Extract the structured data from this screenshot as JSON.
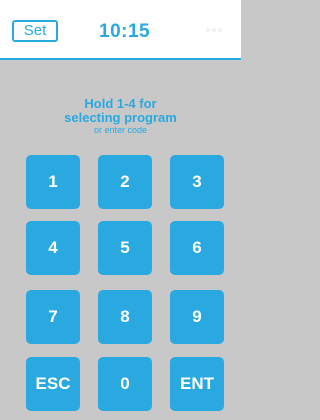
{
  "header": {
    "set_label": "Set",
    "time": "10:15"
  },
  "prompt": {
    "line1": "Hold 1-4 for",
    "line2": "selecting program",
    "line3": "or enter code"
  },
  "keypad": {
    "keys": [
      "1",
      "2",
      "3",
      "4",
      "5",
      "6",
      "7",
      "8",
      "9",
      "ESC",
      "0",
      "ENT"
    ]
  },
  "colors": {
    "accent": "#29a9e0",
    "background": "#c8c8c8",
    "header_background": "#ffffff",
    "key_text": "#ffffff"
  },
  "icons": {
    "header_right": "faint-indicator-icon"
  }
}
